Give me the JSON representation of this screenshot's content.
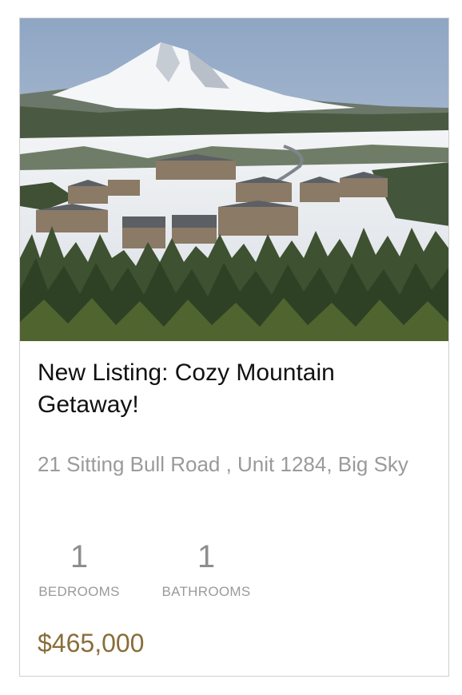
{
  "listing": {
    "title": "New Listing: Cozy Mountain Getaway!",
    "address": "21 Sitting Bull Road , Unit 1284, Big Sky",
    "bedrooms": {
      "value": "1",
      "label": "BEDROOMS"
    },
    "bathrooms": {
      "value": "1",
      "label": "BATHROOMS"
    },
    "price": "$465,000",
    "price_color": "#8a6d3b"
  }
}
